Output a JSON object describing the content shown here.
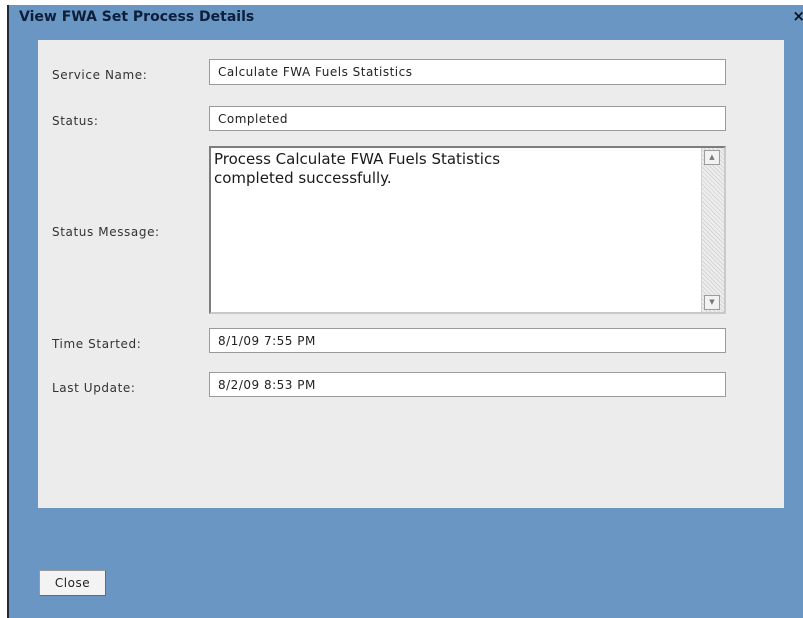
{
  "dialog": {
    "title": "View FWA Set Process Details",
    "close_glyph": "×"
  },
  "form": {
    "service_name_label": "Service Name:",
    "service_name_value": "Calculate FWA Fuels Statistics",
    "status_label": "Status:",
    "status_value": "Completed",
    "status_message_label": "Status Message:",
    "status_message_value": "Process Calculate FWA Fuels Statistics\ncompleted successfully.",
    "time_started_label": "Time Started:",
    "time_started_value": "8/1/09 7:55 PM",
    "last_update_label": "Last Update:",
    "last_update_value": "8/2/09 8:53 PM"
  },
  "scrollbar": {
    "up_glyph": "▲",
    "down_glyph": "▼"
  },
  "footer": {
    "close_label": "Close"
  },
  "colors": {
    "dialog_background": "#6a96c3",
    "panel_background": "#ececec",
    "title_text": "#0c1e3a"
  }
}
